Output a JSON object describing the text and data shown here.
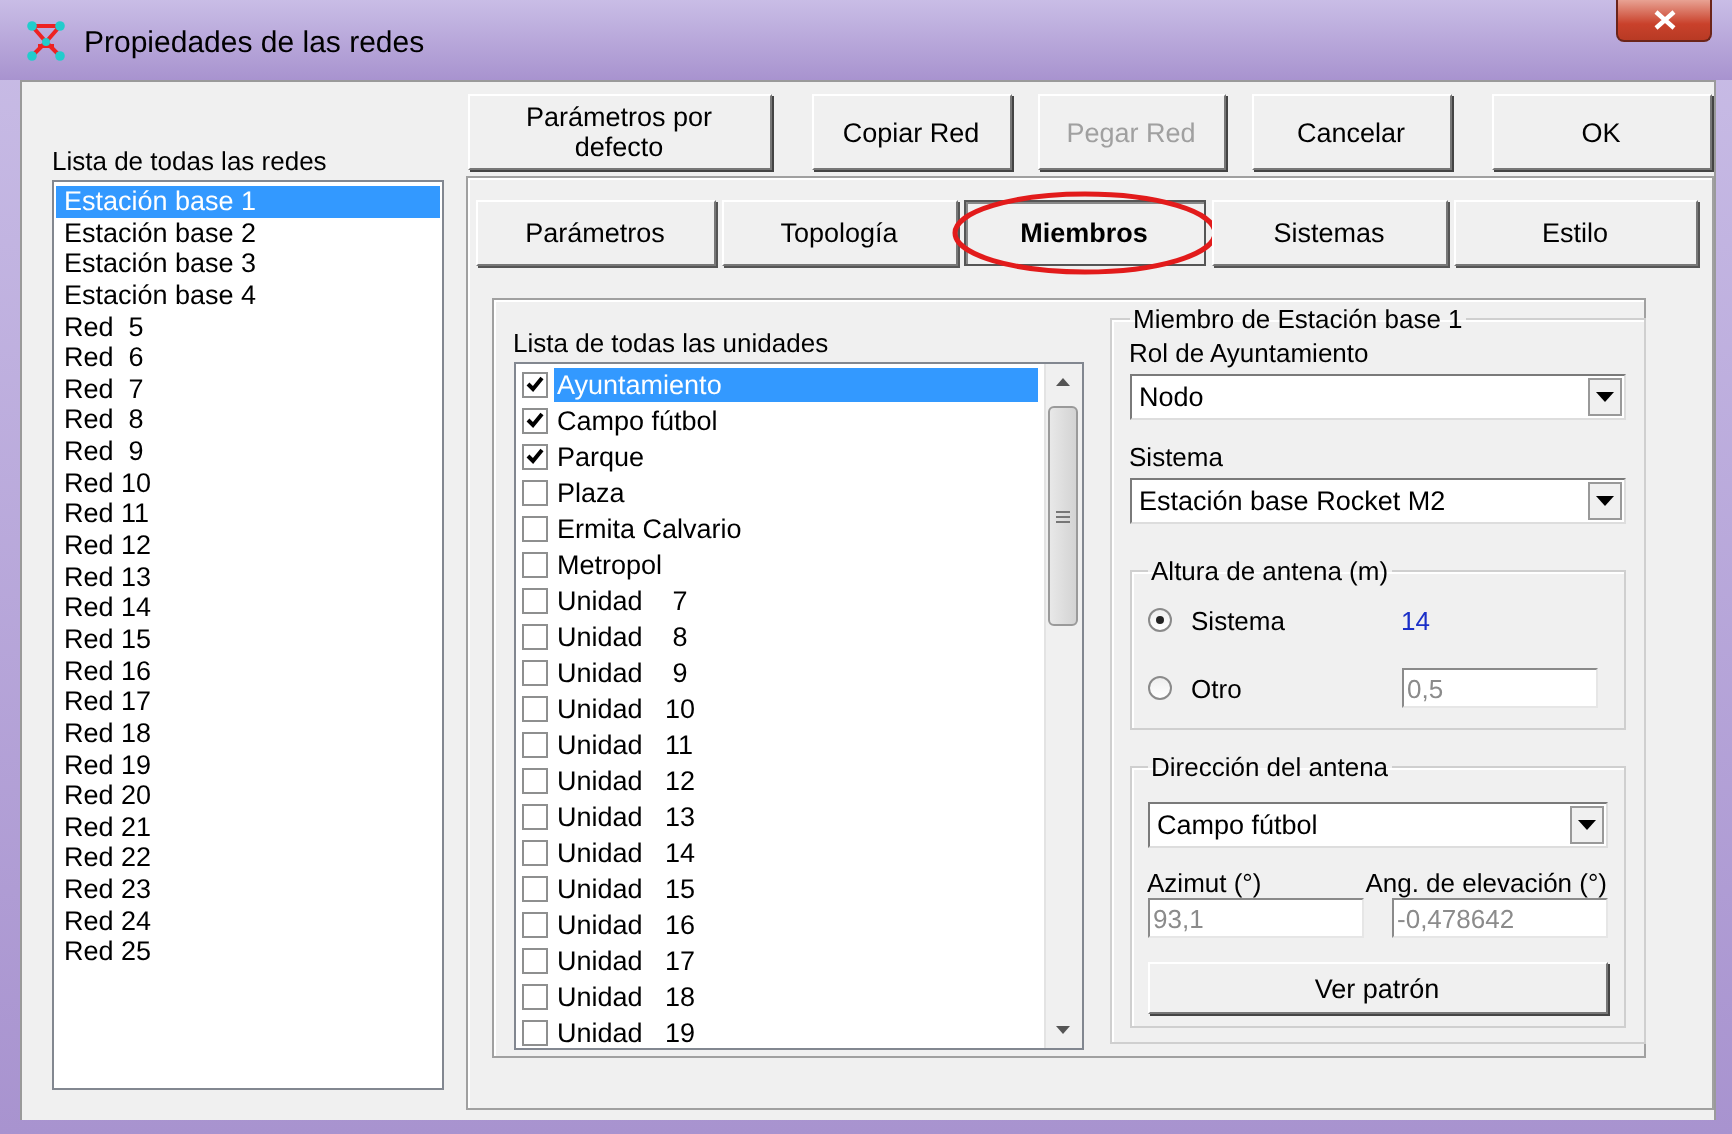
{
  "window": {
    "title": "Propiedades de las redes"
  },
  "networks": {
    "label": "Lista de todas las redes",
    "items": [
      {
        "label": "Estación base 1",
        "selected": true
      },
      {
        "label": "Estación base 2",
        "selected": false
      },
      {
        "label": "Estación base 3",
        "selected": false
      },
      {
        "label": "Estación base 4",
        "selected": false
      },
      {
        "label": "Red  5",
        "selected": false
      },
      {
        "label": "Red  6",
        "selected": false
      },
      {
        "label": "Red  7",
        "selected": false
      },
      {
        "label": "Red  8",
        "selected": false
      },
      {
        "label": "Red  9",
        "selected": false
      },
      {
        "label": "Red 10",
        "selected": false
      },
      {
        "label": "Red 11",
        "selected": false
      },
      {
        "label": "Red 12",
        "selected": false
      },
      {
        "label": "Red 13",
        "selected": false
      },
      {
        "label": "Red 14",
        "selected": false
      },
      {
        "label": "Red 15",
        "selected": false
      },
      {
        "label": "Red 16",
        "selected": false
      },
      {
        "label": "Red 17",
        "selected": false
      },
      {
        "label": "Red 18",
        "selected": false
      },
      {
        "label": "Red 19",
        "selected": false
      },
      {
        "label": "Red 20",
        "selected": false
      },
      {
        "label": "Red 21",
        "selected": false
      },
      {
        "label": "Red 22",
        "selected": false
      },
      {
        "label": "Red 23",
        "selected": false
      },
      {
        "label": "Red 24",
        "selected": false
      },
      {
        "label": "Red 25",
        "selected": false
      }
    ]
  },
  "buttons": [
    {
      "label": "Parámetros por defecto",
      "disabled": false
    },
    {
      "label": "Copiar Red",
      "disabled": false
    },
    {
      "label": "Pegar Red",
      "disabled": true
    },
    {
      "label": "Cancelar",
      "disabled": false
    },
    {
      "label": "OK",
      "disabled": false
    }
  ],
  "tabs": [
    {
      "label": "Parámetros",
      "selected": false,
      "highlighted": false
    },
    {
      "label": "Topología",
      "selected": false,
      "highlighted": false
    },
    {
      "label": "Miembros",
      "selected": true,
      "highlighted": true
    },
    {
      "label": "Sistemas",
      "selected": false,
      "highlighted": false
    },
    {
      "label": "Estilo",
      "selected": false,
      "highlighted": false
    }
  ],
  "units": {
    "label": "Lista de todas las unidades",
    "items": [
      {
        "label": "Ayuntamiento",
        "checked": true,
        "selected": true
      },
      {
        "label": "Campo fútbol",
        "checked": true,
        "selected": false
      },
      {
        "label": "Parque",
        "checked": true,
        "selected": false
      },
      {
        "label": "Plaza",
        "checked": false,
        "selected": false
      },
      {
        "label": "Ermita Calvario",
        "checked": false,
        "selected": false
      },
      {
        "label": "Metropol",
        "checked": false,
        "selected": false
      },
      {
        "label": "Unidad    7",
        "checked": false,
        "selected": false
      },
      {
        "label": "Unidad    8",
        "checked": false,
        "selected": false
      },
      {
        "label": "Unidad    9",
        "checked": false,
        "selected": false
      },
      {
        "label": "Unidad   10",
        "checked": false,
        "selected": false
      },
      {
        "label": "Unidad   11",
        "checked": false,
        "selected": false
      },
      {
        "label": "Unidad   12",
        "checked": false,
        "selected": false
      },
      {
        "label": "Unidad   13",
        "checked": false,
        "selected": false
      },
      {
        "label": "Unidad   14",
        "checked": false,
        "selected": false
      },
      {
        "label": "Unidad   15",
        "checked": false,
        "selected": false
      },
      {
        "label": "Unidad   16",
        "checked": false,
        "selected": false
      },
      {
        "label": "Unidad   17",
        "checked": false,
        "selected": false
      },
      {
        "label": "Unidad   18",
        "checked": false,
        "selected": false
      },
      {
        "label": "Unidad   19",
        "checked": false,
        "selected": false
      }
    ]
  },
  "member": {
    "title": "Miembro de Estación base 1",
    "role_label": "Rol de Ayuntamiento",
    "role_value": "Nodo",
    "system_label": "Sistema",
    "system_value": "Estación base Rocket M2",
    "height": {
      "title": "Altura de antena (m)",
      "options": [
        {
          "label": "Sistema",
          "selected": true,
          "value": "14",
          "kind": "reading"
        },
        {
          "label": "Otro",
          "selected": false,
          "value": "0,5",
          "kind": "field",
          "disabled": true
        }
      ]
    },
    "direction": {
      "title": "Dirección del antena",
      "target": "Campo fútbol",
      "azimuth_label": "Azimut (°)",
      "azimuth": {
        "value": "93,1",
        "disabled": true
      },
      "elevation_label": "Ang. de elevación (°)",
      "elevation": {
        "value": "-0,478642",
        "disabled": true
      },
      "pattern_button": "Ver patrón"
    }
  }
}
